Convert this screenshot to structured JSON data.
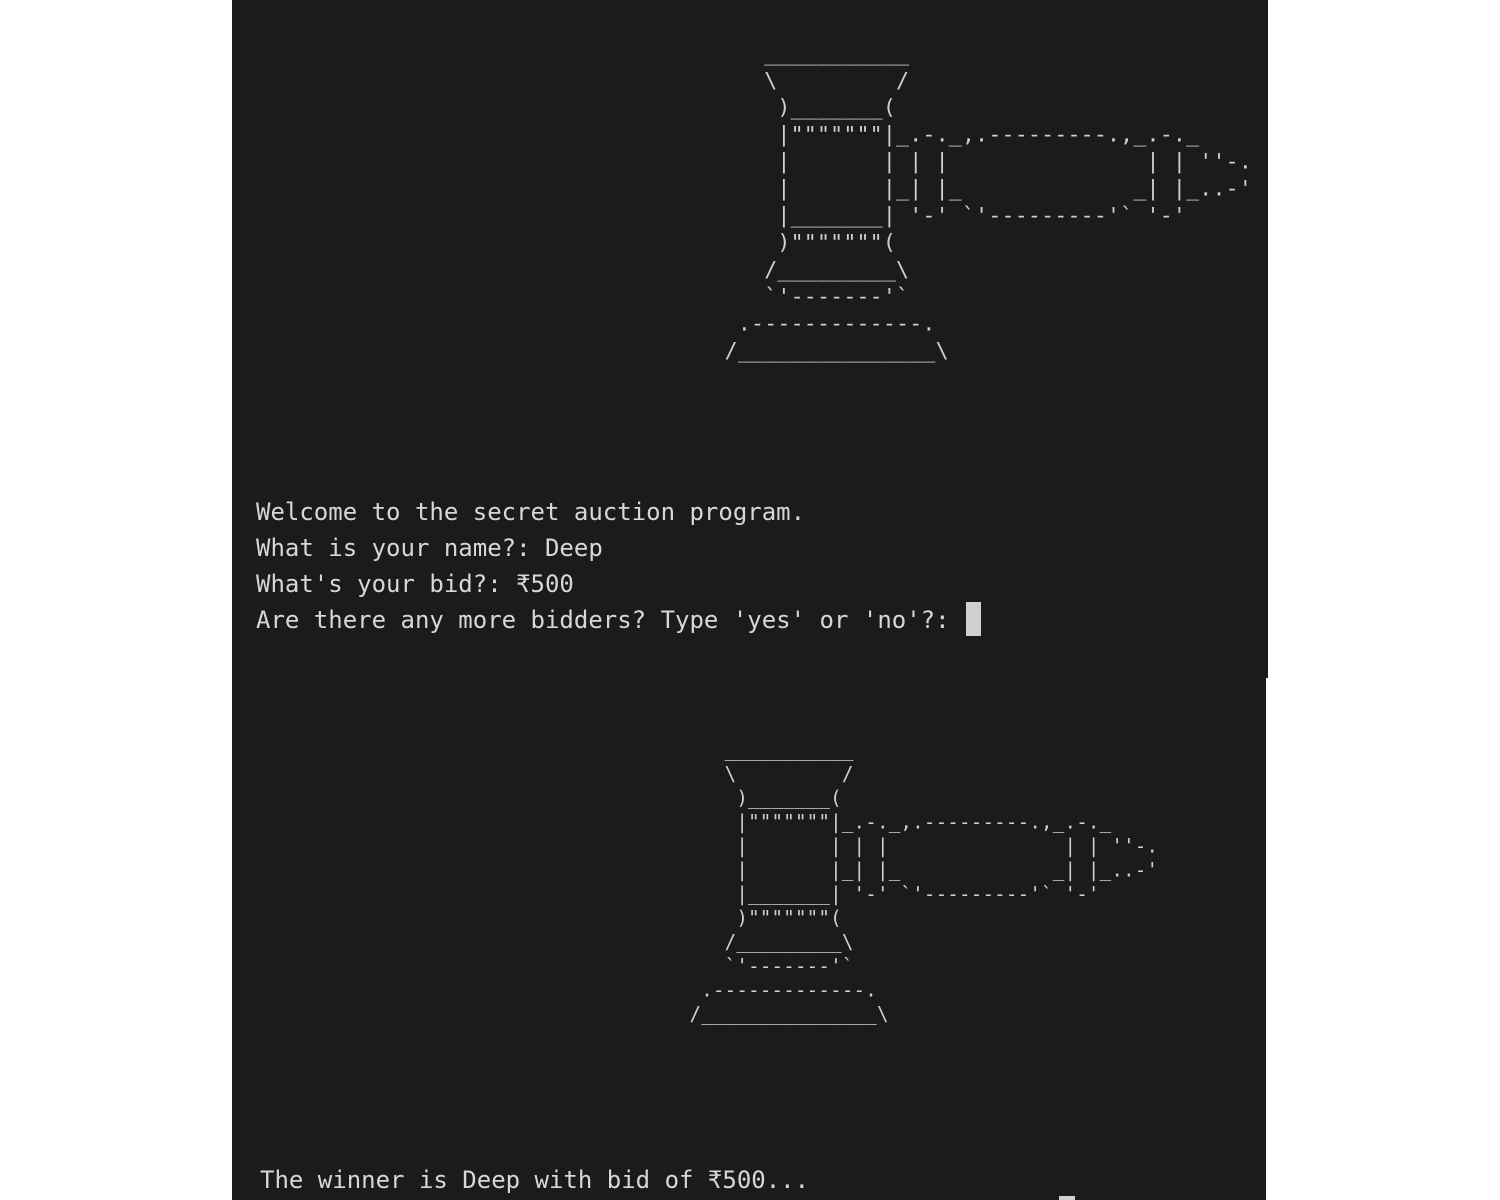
{
  "terminal_top": {
    "ascii_art": "            ___________\n            \\         /\n             )_______(\n             |\"\"\"\"\"\"\"|_.-._,.---------.,_.-._\n             |       | | |               | | ''-.\n             |       |_| |_             _| |_..-'\n             |_______| '-' `'---------'` '-'\n             )\"\"\"\"\"\"\"(\n            /_________\\\n            `'-------'`\n          .-------------.\n         /_______________\\",
    "lines": [
      "Welcome to the secret auction program.",
      "What is your name?: Deep",
      "What's your bid?: ₹500",
      "Are there any more bidders? Type 'yes' or 'no'?: "
    ]
  },
  "terminal_bottom": {
    "ascii_art": "            ___________\n            \\         /\n             )_______(\n             |\"\"\"\"\"\"\"|_.-._,.---------.,_.-._\n             |       | | |               | | ''-.\n             |       |_| |_             _| |_..-'\n             |_______| '-' `'---------'` '-'\n             )\"\"\"\"\"\"\"(\n            /_________\\\n            `'-------'`\n          .-------------.\n         /_______________\\",
    "result": "The winner is Deep with bid of ₹500..."
  }
}
